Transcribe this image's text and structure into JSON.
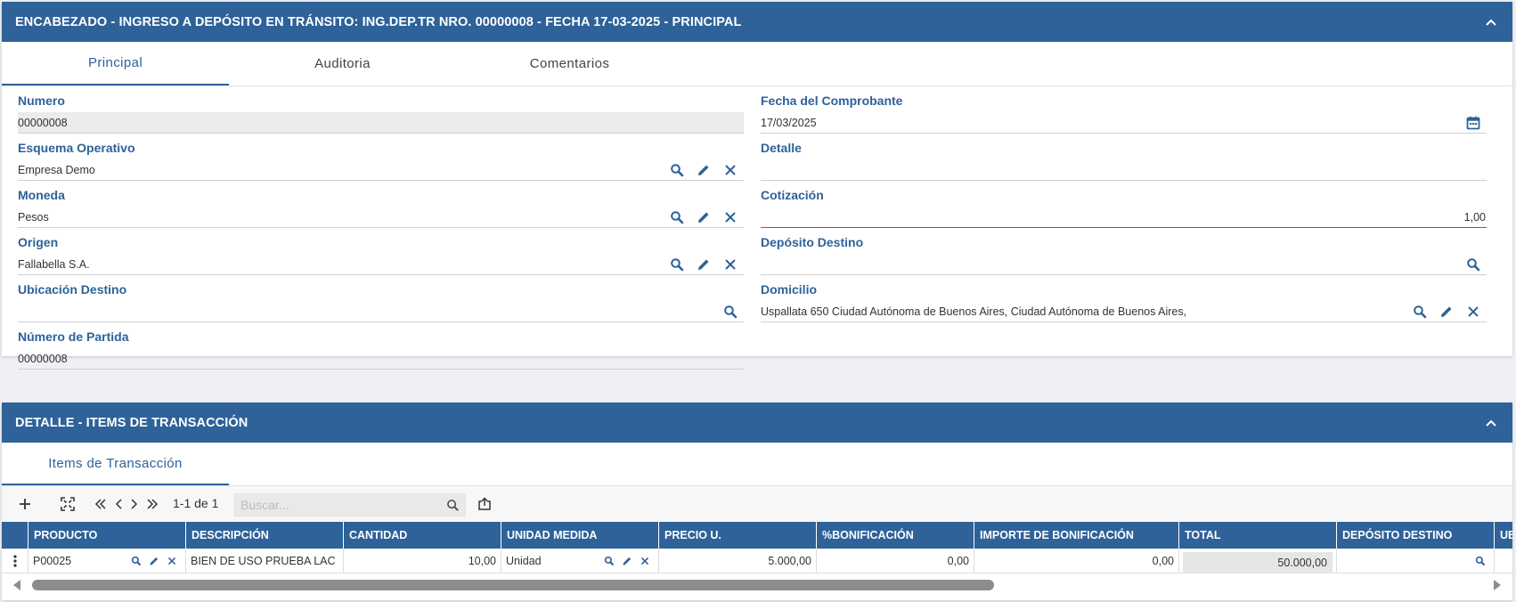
{
  "header_panel": {
    "title": "ENCABEZADO - INGRESO A DEPÓSITO EN TRÁNSITO: ING.DEP.TR NRO. 00000008 - FECHA 17-03-2025 - PRINCIPAL",
    "tabs": [
      {
        "label": "Principal",
        "active": true
      },
      {
        "label": "Auditoria",
        "active": false
      },
      {
        "label": "Comentarios",
        "active": false
      }
    ],
    "fields": {
      "numero": {
        "label": "Numero",
        "value": "00000008"
      },
      "fecha": {
        "label": "Fecha del Comprobante",
        "value": "17/03/2025"
      },
      "esquema": {
        "label": "Esquema Operativo",
        "value": "Empresa Demo"
      },
      "detalle": {
        "label": "Detalle",
        "value": ""
      },
      "moneda": {
        "label": "Moneda",
        "value": "Pesos"
      },
      "cotizacion": {
        "label": "Cotización",
        "value": "1,00"
      },
      "origen": {
        "label": "Origen",
        "value": "Fallabella S.A."
      },
      "deposito_destino": {
        "label": "Depósito Destino",
        "value": ""
      },
      "ubicacion_destino": {
        "label": "Ubicación Destino",
        "value": ""
      },
      "domicilio": {
        "label": "Domicilio",
        "value": "Uspallata 650  Ciudad Autónoma de Buenos Aires, Ciudad Autónoma de Buenos Aires,"
      },
      "numero_partida": {
        "label": "Número de Partida",
        "value": "00000008"
      }
    }
  },
  "detail_panel": {
    "title": "DETALLE - ITEMS DE TRANSACCIÓN",
    "tab": "Items de Transacción",
    "toolbar": {
      "pager_text": "1-1 de 1",
      "search_placeholder": "Buscar..."
    },
    "columns": [
      "PRODUCTO",
      "DESCRIPCIÓN",
      "CANTIDAD",
      "UNIDAD MEDIDA",
      "PRECIO U.",
      "%BONIFICACIÓN",
      "IMPORTE DE BONIFICACIÓN",
      "TOTAL",
      "DEPÓSITO DESTINO",
      "UB"
    ],
    "rows": [
      {
        "producto": "P00025",
        "descripcion": "BIEN DE USO PRUEBA LAC",
        "cantidad": "10,00",
        "unidad": "Unidad",
        "precio": "5.000,00",
        "bonificacion": "0,00",
        "importe_bonificacion": "0,00",
        "total": "50.000,00",
        "deposito": ""
      }
    ]
  },
  "colors": {
    "primary": "#2e6299",
    "header_text": "#ffffff"
  },
  "icons": [
    "chevron-up-icon",
    "search-icon",
    "edit-icon",
    "close-icon",
    "calendar-icon",
    "add-icon",
    "expand-icon",
    "first-page-icon",
    "prev-page-icon",
    "next-page-icon",
    "last-page-icon",
    "export-icon",
    "more-vert-icon"
  ]
}
